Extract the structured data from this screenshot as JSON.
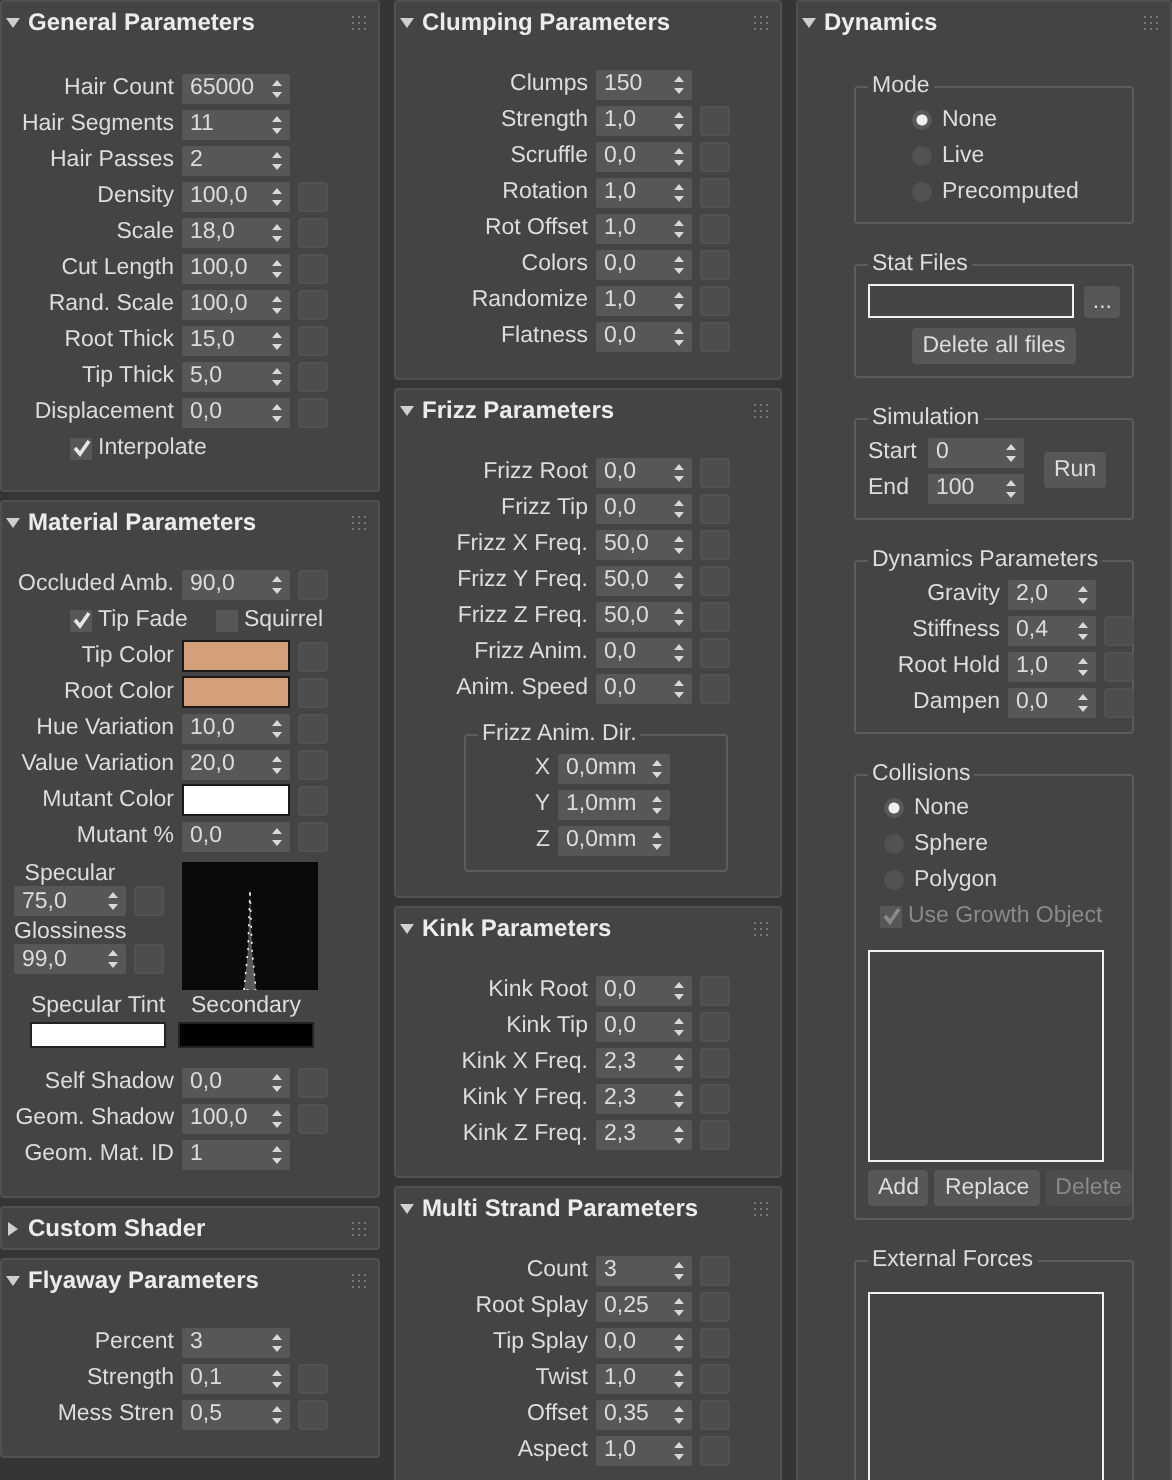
{
  "columns": [
    {
      "rollouts": [
        {
          "title": "General Parameters",
          "expanded": true,
          "rows": [
            {
              "kind": "spinner",
              "label": "Hair Count",
              "value": "65000",
              "map": false
            },
            {
              "kind": "spinner",
              "label": "Hair Segments",
              "value": "11",
              "map": false
            },
            {
              "kind": "spinner",
              "label": "Hair Passes",
              "value": "2",
              "map": false
            },
            {
              "kind": "spinner",
              "label": "Density",
              "value": "100,0",
              "map": true
            },
            {
              "kind": "spinner",
              "label": "Scale",
              "value": "18,0",
              "map": true
            },
            {
              "kind": "spinner",
              "label": "Cut Length",
              "value": "100,0",
              "map": true
            },
            {
              "kind": "spinner",
              "label": "Rand. Scale",
              "value": "100,0",
              "map": true
            },
            {
              "kind": "spinner",
              "label": "Root Thick",
              "value": "15,0",
              "map": true
            },
            {
              "kind": "spinner",
              "label": "Tip Thick",
              "value": "5,0",
              "map": true
            },
            {
              "kind": "spinner",
              "label": "Displacement",
              "value": "0,0",
              "map": true
            },
            {
              "kind": "checkbox",
              "label": "Interpolate",
              "checked": true
            }
          ]
        },
        {
          "title": "Material Parameters",
          "expanded": true,
          "rows": [
            {
              "kind": "spinner",
              "label": "Occluded Amb.",
              "value": "90,0",
              "map": true
            },
            {
              "kind": "checks",
              "items": [
                {
                  "label": "Tip Fade",
                  "checked": true
                },
                {
                  "label": "Squirrel",
                  "checked": false
                }
              ]
            },
            {
              "kind": "color",
              "label": "Tip Color",
              "color": "#d4a07c",
              "map": true
            },
            {
              "kind": "color",
              "label": "Root Color",
              "color": "#d4a07c",
              "map": true
            },
            {
              "kind": "spinner",
              "label": "Hue Variation",
              "value": "10,0",
              "map": true
            },
            {
              "kind": "spinner",
              "label": "Value Variation",
              "value": "20,0",
              "map": true
            },
            {
              "kind": "color",
              "label": "Mutant Color",
              "color": "#ffffff",
              "map": true
            },
            {
              "kind": "spinner",
              "label": "Mutant %",
              "value": "0,0",
              "map": true
            },
            {
              "kind": "specular",
              "spinners": [
                {
                  "label": "Specular",
                  "value": "75,0"
                },
                {
                  "label": "Glossiness",
                  "value": "99,0"
                }
              ]
            },
            {
              "kind": "swatches",
              "items": [
                {
                  "label": "Specular Tint",
                  "color": "#ffffff"
                },
                {
                  "label": "Secondary",
                  "color": "#000000"
                }
              ]
            },
            {
              "kind": "spinner",
              "label": "Self Shadow",
              "value": "0,0",
              "map": true
            },
            {
              "kind": "spinner",
              "label": "Geom. Shadow",
              "value": "100,0",
              "map": true
            },
            {
              "kind": "spinner",
              "label": "Geom. Mat. ID",
              "value": "1",
              "map": false
            }
          ]
        },
        {
          "title": "Custom Shader",
          "expanded": false
        },
        {
          "title": "Flyaway Parameters",
          "expanded": true,
          "rows": [
            {
              "kind": "spinner",
              "label": "Percent",
              "value": "3",
              "map": false
            },
            {
              "kind": "spinner",
              "label": "Strength",
              "value": "0,1",
              "map": true
            },
            {
              "kind": "spinner",
              "label": "Mess Stren",
              "value": "0,5",
              "map": true
            }
          ]
        }
      ]
    },
    {
      "rollouts": [
        {
          "title": "Clumping Parameters",
          "expanded": true,
          "rows": [
            {
              "kind": "spinner",
              "label": "Clumps",
              "value": "150",
              "map": false
            },
            {
              "kind": "spinner",
              "label": "Strength",
              "value": "1,0",
              "map": true
            },
            {
              "kind": "spinner",
              "label": "Scruffle",
              "value": "0,0",
              "map": true
            },
            {
              "kind": "spinner",
              "label": "Rotation",
              "value": "1,0",
              "map": true
            },
            {
              "kind": "spinner",
              "label": "Rot Offset",
              "value": "1,0",
              "map": true
            },
            {
              "kind": "spinner",
              "label": "Colors",
              "value": "0,0",
              "map": true
            },
            {
              "kind": "spinner",
              "label": "Randomize",
              "value": "1,0",
              "map": true
            },
            {
              "kind": "spinner",
              "label": "Flatness",
              "value": "0,0",
              "map": true
            }
          ]
        },
        {
          "title": "Frizz Parameters",
          "expanded": true,
          "rows": [
            {
              "kind": "spinner",
              "label": "Frizz Root",
              "value": "0,0",
              "map": true
            },
            {
              "kind": "spinner",
              "label": "Frizz Tip",
              "value": "0,0",
              "map": true
            },
            {
              "kind": "spinner",
              "label": "Frizz X Freq.",
              "value": "50,0",
              "map": true
            },
            {
              "kind": "spinner",
              "label": "Frizz Y Freq.",
              "value": "50,0",
              "map": true
            },
            {
              "kind": "spinner",
              "label": "Frizz Z Freq.",
              "value": "50,0",
              "map": true
            },
            {
              "kind": "spinner",
              "label": "Frizz Anim.",
              "value": "0,0",
              "map": true
            },
            {
              "kind": "spinner",
              "label": "Anim. Speed",
              "value": "0,0",
              "map": true
            },
            {
              "kind": "group",
              "title": "Frizz Anim. Dir.",
              "rows": [
                {
                  "kind": "spinner",
                  "label": "X",
                  "value": "0,0mm",
                  "map": false
                },
                {
                  "kind": "spinner",
                  "label": "Y",
                  "value": "1,0mm",
                  "map": false
                },
                {
                  "kind": "spinner",
                  "label": "Z",
                  "value": "0,0mm",
                  "map": false
                }
              ]
            }
          ]
        },
        {
          "title": "Kink Parameters",
          "expanded": true,
          "rows": [
            {
              "kind": "spinner",
              "label": "Kink Root",
              "value": "0,0",
              "map": true
            },
            {
              "kind": "spinner",
              "label": "Kink Tip",
              "value": "0,0",
              "map": true
            },
            {
              "kind": "spinner",
              "label": "Kink X Freq.",
              "value": "2,3",
              "map": true
            },
            {
              "kind": "spinner",
              "label": "Kink Y Freq.",
              "value": "2,3",
              "map": true
            },
            {
              "kind": "spinner",
              "label": "Kink Z Freq.",
              "value": "2,3",
              "map": true
            }
          ]
        },
        {
          "title": "Multi Strand Parameters",
          "expanded": true,
          "rows": [
            {
              "kind": "spinner",
              "label": "Count",
              "value": "3",
              "map": true
            },
            {
              "kind": "spinner",
              "label": "Root Splay",
              "value": "0,25",
              "map": true
            },
            {
              "kind": "spinner",
              "label": "Tip Splay",
              "value": "0,0",
              "map": true
            },
            {
              "kind": "spinner",
              "label": "Twist",
              "value": "1,0",
              "map": true
            },
            {
              "kind": "spinner",
              "label": "Offset",
              "value": "0,35",
              "map": true
            },
            {
              "kind": "spinner",
              "label": "Aspect",
              "value": "1,0",
              "map": true
            }
          ]
        }
      ]
    },
    {
      "rollouts": [
        {
          "title": "Dynamics",
          "expanded": true,
          "rows": [
            {
              "kind": "group",
              "title": "Mode",
              "rows": [
                {
                  "kind": "radio",
                  "label": "None",
                  "selected": true
                },
                {
                  "kind": "radio",
                  "label": "Live",
                  "selected": false
                },
                {
                  "kind": "radio",
                  "label": "Precomputed",
                  "selected": false
                }
              ]
            },
            {
              "kind": "group",
              "title": "Stat Files",
              "rows": [
                {
                  "kind": "file",
                  "button": "..."
                },
                {
                  "kind": "button",
                  "label": "Delete all files"
                }
              ]
            },
            {
              "kind": "group",
              "title": "Simulation",
              "rows": [
                {
                  "kind": "sim",
                  "spinners": [
                    {
                      "label": "Start",
                      "value": "0"
                    },
                    {
                      "label": "End",
                      "value": "100"
                    }
                  ],
                  "button": "Run"
                }
              ]
            },
            {
              "kind": "group",
              "title": "Dynamics Parameters",
              "rows": [
                {
                  "kind": "spinner",
                  "label": "Gravity",
                  "value": "2,0",
                  "map": false
                },
                {
                  "kind": "spinner",
                  "label": "Stiffness",
                  "value": "0,4",
                  "map": true
                },
                {
                  "kind": "spinner",
                  "label": "Root Hold",
                  "value": "1,0",
                  "map": true
                },
                {
                  "kind": "spinner",
                  "label": "Dampen",
                  "value": "0,0",
                  "map": true
                }
              ]
            },
            {
              "kind": "group",
              "title": "Collisions",
              "rows": [
                {
                  "kind": "radio",
                  "label": "None",
                  "selected": true
                },
                {
                  "kind": "radio",
                  "label": "Sphere",
                  "selected": false
                },
                {
                  "kind": "radio",
                  "label": "Polygon",
                  "selected": false
                },
                {
                  "kind": "checkbox",
                  "label": "Use Growth Object",
                  "checked": true,
                  "disabled": true
                },
                {
                  "kind": "listbox"
                },
                {
                  "kind": "buttons",
                  "items": [
                    {
                      "label": "Add",
                      "disabled": false
                    },
                    {
                      "label": "Replace",
                      "disabled": false
                    },
                    {
                      "label": "Delete",
                      "disabled": true
                    }
                  ]
                }
              ]
            },
            {
              "kind": "group",
              "title": "External Forces",
              "rows": [
                {
                  "kind": "listbox"
                }
              ]
            }
          ]
        }
      ]
    }
  ]
}
